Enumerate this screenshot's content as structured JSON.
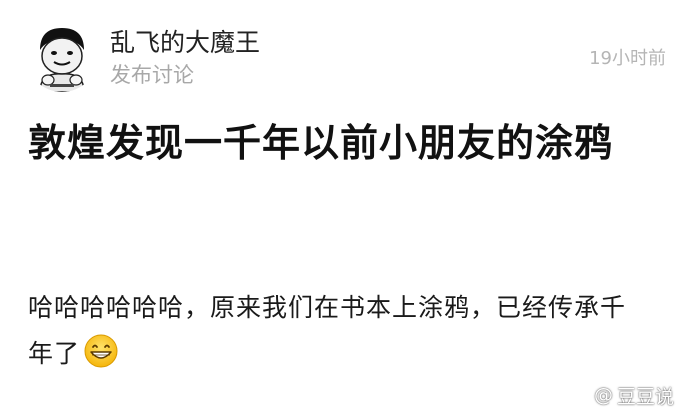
{
  "post": {
    "author_name": "乱飞的大魔王",
    "post_type": "发布讨论",
    "timestamp": "19小时前",
    "title": "敦煌发现一千年以前小朋友的涂鸦",
    "body": "哈哈哈哈哈哈，原来我们在书本上涂鸦，已经传承千年了",
    "body_emoji": "grinning-face-icon"
  },
  "avatar": {
    "icon": "meme-face-avatar"
  },
  "watermark": {
    "at_prefix": "@",
    "text": "豆豆说",
    "icon": "weibo-icon"
  }
}
